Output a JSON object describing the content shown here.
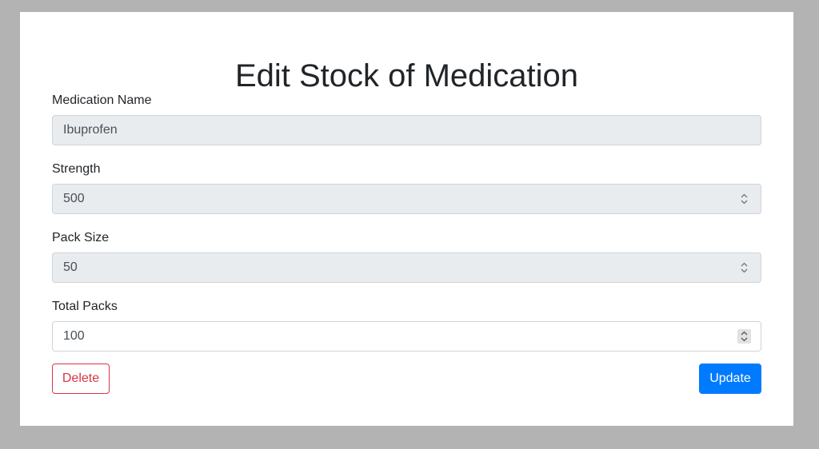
{
  "page": {
    "title": "Edit Stock of Medication"
  },
  "form": {
    "medication_name": {
      "label": "Medication Name",
      "value": "Ibuprofen",
      "readonly": true
    },
    "strength": {
      "label": "Strength",
      "value": "500",
      "readonly": true
    },
    "pack_size": {
      "label": "Pack Size",
      "value": "50",
      "readonly": true
    },
    "total_packs": {
      "label": "Total Packs",
      "value": "100",
      "readonly": false
    }
  },
  "actions": {
    "delete_label": "Delete",
    "update_label": "Update"
  },
  "colors": {
    "backdrop": "#b3b3b3",
    "readonly_bg": "#e9ecef",
    "danger": "#dc3545",
    "primary": "#007bff"
  },
  "icons": {
    "stepper": "up-down-chevron-icon"
  }
}
